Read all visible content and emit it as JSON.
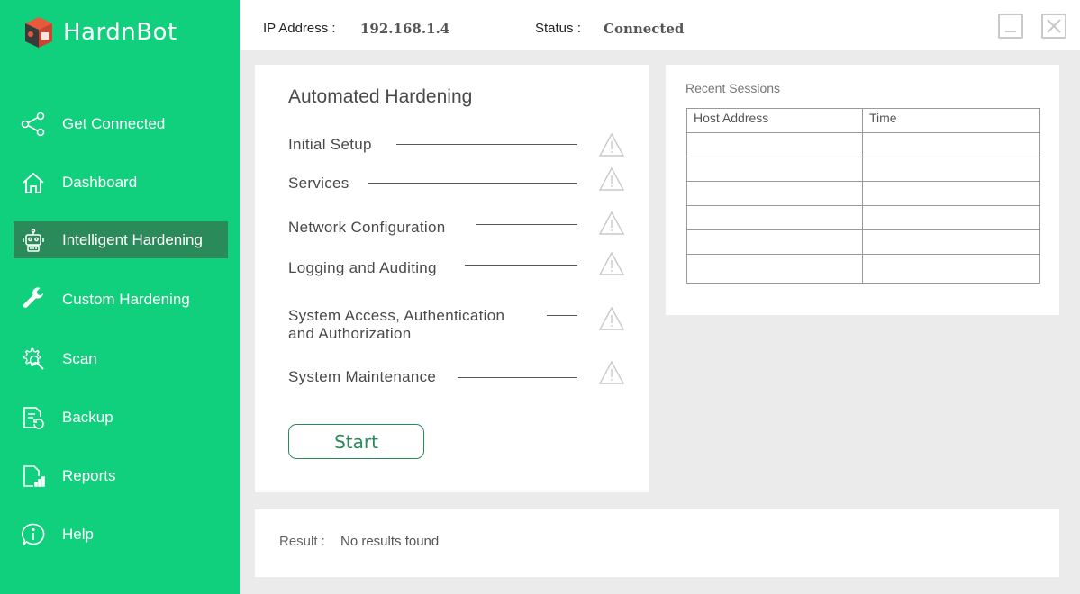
{
  "app": {
    "name": "HardnBot"
  },
  "sidebar": {
    "items": [
      {
        "label": "Get Connected",
        "icon": "share-nodes-icon",
        "active": false
      },
      {
        "label": "Dashboard",
        "icon": "home-icon",
        "active": false
      },
      {
        "label": "Intelligent Hardening",
        "icon": "robot-icon",
        "active": true
      },
      {
        "label": "Custom Hardening",
        "icon": "wrench-icon",
        "active": false
      },
      {
        "label": "Scan",
        "icon": "gear-search-icon",
        "active": false
      },
      {
        "label": "Backup",
        "icon": "backup-document-icon",
        "active": false
      },
      {
        "label": "Reports",
        "icon": "report-chart-icon",
        "active": false
      },
      {
        "label": "Help",
        "icon": "info-icon",
        "active": false
      }
    ]
  },
  "header": {
    "ip_label": "IP Address :",
    "ip_value": "192.168.1.4",
    "status_label": "Status :",
    "status_value": "Connected"
  },
  "hardening": {
    "title": "Automated Hardening",
    "steps": [
      {
        "label": "Initial Setup",
        "status": "warning"
      },
      {
        "label": "Services",
        "status": "warning"
      },
      {
        "label": "Network Configuration",
        "status": "warning"
      },
      {
        "label": "Logging and Auditing",
        "status": "warning"
      },
      {
        "label": "System Access, Authentication and Authorization",
        "line1": "System Access, Authentication",
        "line2": "and Authorization",
        "status": "warning"
      },
      {
        "label": "System Maintenance",
        "status": "warning"
      }
    ],
    "start_label": "Start"
  },
  "recent_sessions": {
    "title": "Recent Sessions",
    "columns": [
      "Host Address",
      "Time"
    ],
    "rows": [
      [
        "",
        ""
      ],
      [
        "",
        ""
      ],
      [
        "",
        ""
      ],
      [
        "",
        ""
      ],
      [
        "",
        ""
      ],
      [
        "",
        ""
      ]
    ]
  },
  "result": {
    "label": "Result :",
    "value": "No results found"
  },
  "colors": {
    "sidebar_bg": "#10cf7d",
    "active_bg": "#2b8a5a",
    "accent": "#2b8a5a"
  }
}
